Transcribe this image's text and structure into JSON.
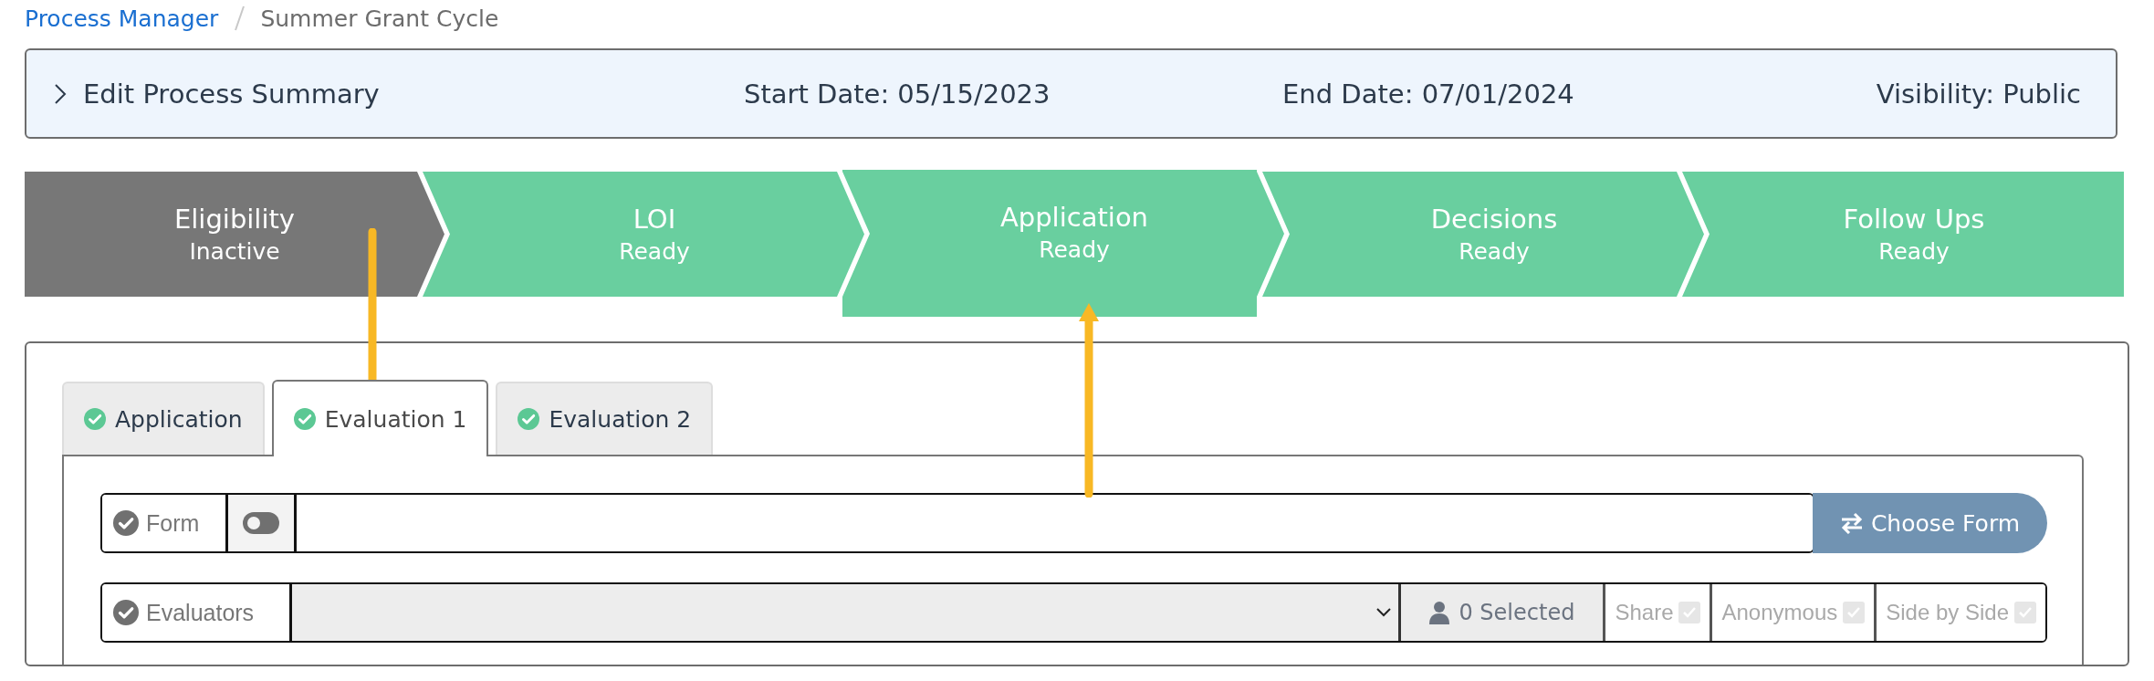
{
  "breadcrumb": [
    {
      "label": "Process Manager",
      "kind": "link"
    },
    {
      "label": "Summer Grant Cycle",
      "kind": "current"
    }
  ],
  "summary": {
    "title": "Edit Process Summary",
    "expanded": false,
    "start_date": "Start Date: 05/15/2023",
    "end_date": "End Date: 07/01/2024",
    "visibility": "Visibility: Public"
  },
  "steps": [
    {
      "name": "Eligibility",
      "status": "Inactive",
      "kind": "inactive",
      "selected": false
    },
    {
      "name": "LOI",
      "status": "Ready",
      "kind": "ready",
      "selected": false
    },
    {
      "name": "Application",
      "status": "Ready",
      "kind": "ready",
      "selected": true
    },
    {
      "name": "Decisions",
      "status": "Ready",
      "kind": "ready",
      "selected": false
    },
    {
      "name": "Follow Ups",
      "status": "Ready",
      "kind": "ready",
      "selected": false
    }
  ],
  "tabs": [
    {
      "label": "Application",
      "complete": true,
      "selected": false
    },
    {
      "label": "Evaluation 1",
      "complete": true,
      "selected": true
    },
    {
      "label": "Evaluation 2",
      "complete": true,
      "selected": false
    }
  ],
  "form_row": {
    "label": "Form",
    "complete": true,
    "toggle_on": false,
    "button": "Choose Form"
  },
  "evaluators_row": {
    "label": "Evaluators",
    "complete": true,
    "selected_count": "0 Selected",
    "options": [
      {
        "label": "Share",
        "checked": true,
        "disabled": true
      },
      {
        "label": "Anonymous",
        "checked": true,
        "disabled": true
      },
      {
        "label": "Side by Side",
        "checked": true,
        "disabled": true
      }
    ]
  }
}
